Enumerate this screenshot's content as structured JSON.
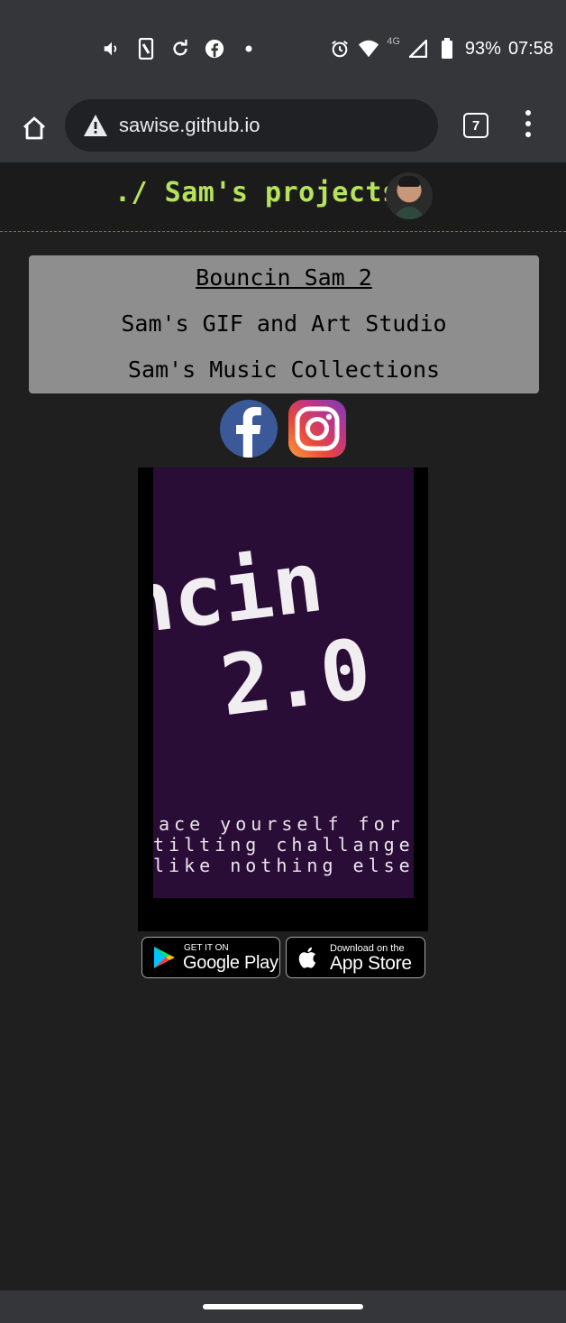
{
  "status_bar": {
    "battery": "93%",
    "time": "07:58",
    "network": "4G",
    "icons": [
      "volume-icon",
      "screenshot-icon",
      "sync-icon",
      "facebook-notification-icon",
      "dot-icon",
      "alarm-icon",
      "wifi-icon",
      "signal-icon",
      "battery-icon"
    ]
  },
  "browser": {
    "url": "sawise.github.io",
    "tab_count": "7",
    "icons": [
      "home-icon",
      "warning-icon",
      "tabs-icon",
      "more-icon"
    ]
  },
  "header": {
    "title": "./ Sam's projects"
  },
  "nav": {
    "items": [
      {
        "label": "Bouncin Sam 2"
      },
      {
        "label": "Sam's GIF and Art Studio"
      },
      {
        "label": "Sam's Music Collections"
      }
    ]
  },
  "social": {
    "icons": [
      "facebook-icon",
      "instagram-icon"
    ]
  },
  "video": {
    "title_line1": "ncin",
    "title_line2": "2.0",
    "tagline_lines": [
      "ace yourself for",
      "tilting challange",
      "like nothing else"
    ]
  },
  "store_badges": {
    "google_play": {
      "small": "GET IT ON",
      "big": "Google Play"
    },
    "app_store": {
      "small": "Download on the",
      "big": "App Store"
    }
  },
  "colors": {
    "accent": "#b6e35a",
    "page_background": "#1f1f1f",
    "nav_background": "#8e8e8e",
    "video_background": "#2a0d37"
  }
}
